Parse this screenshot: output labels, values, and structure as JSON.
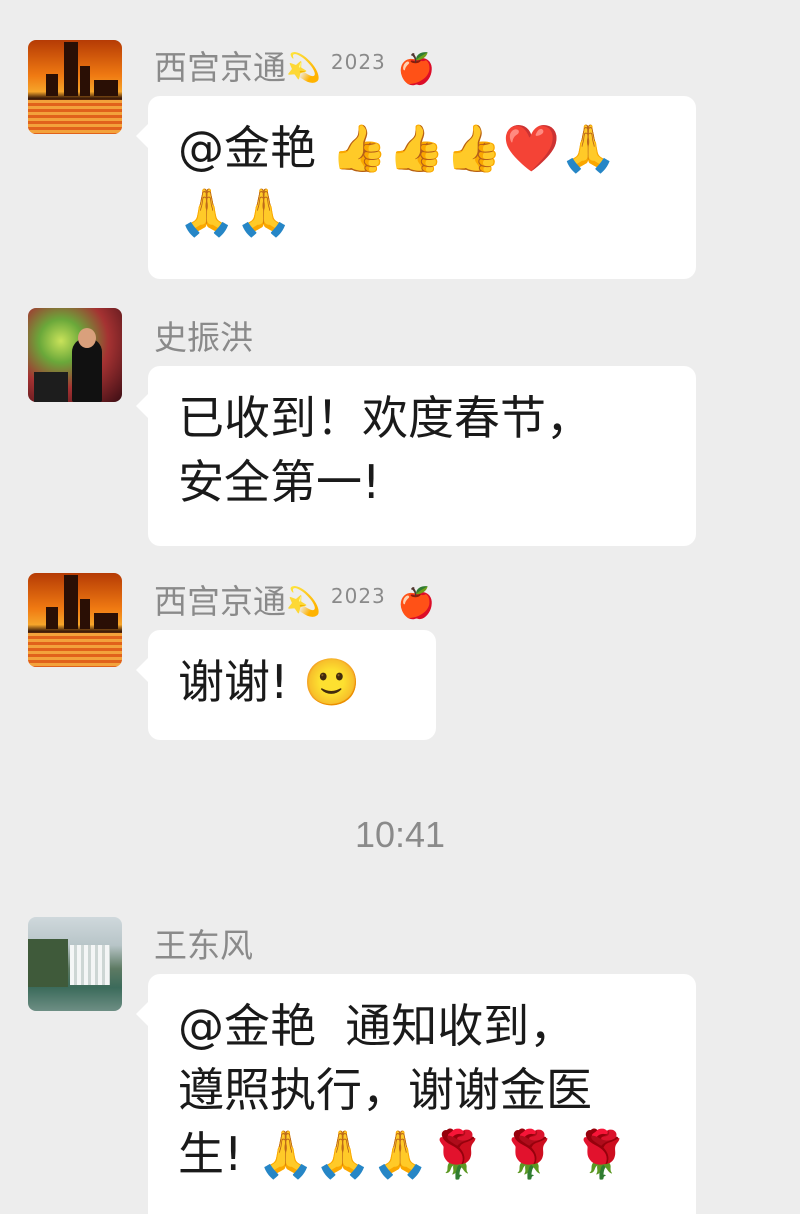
{
  "messages": [
    {
      "sender": "西宫京通",
      "sender_deco": "💫",
      "sender_sup": "2023",
      "sender_apple": "🍎",
      "text": "@金艳 👍👍👍❤️🙏\n🙏🙏"
    },
    {
      "sender": "史振洪",
      "text": "已收到！欢度春节，\n安全第一!"
    },
    {
      "sender": "西宫京通",
      "sender_deco": "💫",
      "sender_sup": "2023",
      "sender_apple": "🍎",
      "text": "谢谢! 🙂"
    },
    {
      "sender": "王东风",
      "text": "@金艳  通知收到，\n遵照执行，谢谢金医\n生! 🙏🙏🙏🌹 🌹 🌹"
    }
  ],
  "timestamp": "10:41",
  "colors": {
    "background": "#ededed",
    "bubble": "#ffffff",
    "sender_name": "#8a8a8a"
  }
}
